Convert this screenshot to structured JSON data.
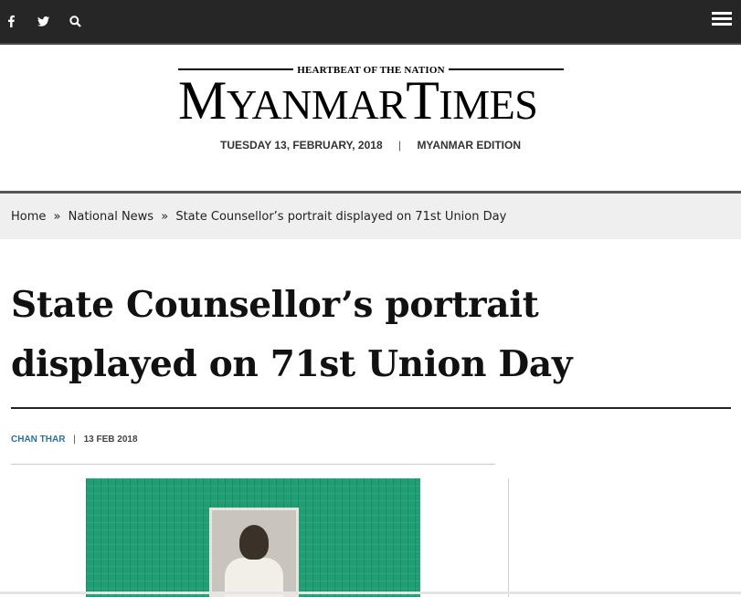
{
  "topbar": {
    "icons": [
      "facebook-icon",
      "twitter-icon",
      "search-icon",
      "menu-icon"
    ],
    "facebook_glyph": "f",
    "twitter_glyph": "🐦"
  },
  "masthead": {
    "tagline": "HEARTBEAT OF THE NATION",
    "logo_text": "MYANMAR TIMES",
    "date": "TUESDAY 13, FEBRUARY, 2018",
    "separator": "|",
    "edition": "MYANMAR EDITION"
  },
  "breadcrumb": {
    "items": [
      "Home",
      "National News",
      "State Counsellor’s portrait displayed on 71st Union Day"
    ],
    "separator": "»"
  },
  "article": {
    "title": "State Counsellor’s portrait displayed on 71st Union Day",
    "author": "CHAN THAR",
    "separator": "|",
    "date": "13 FEB 2018"
  }
}
